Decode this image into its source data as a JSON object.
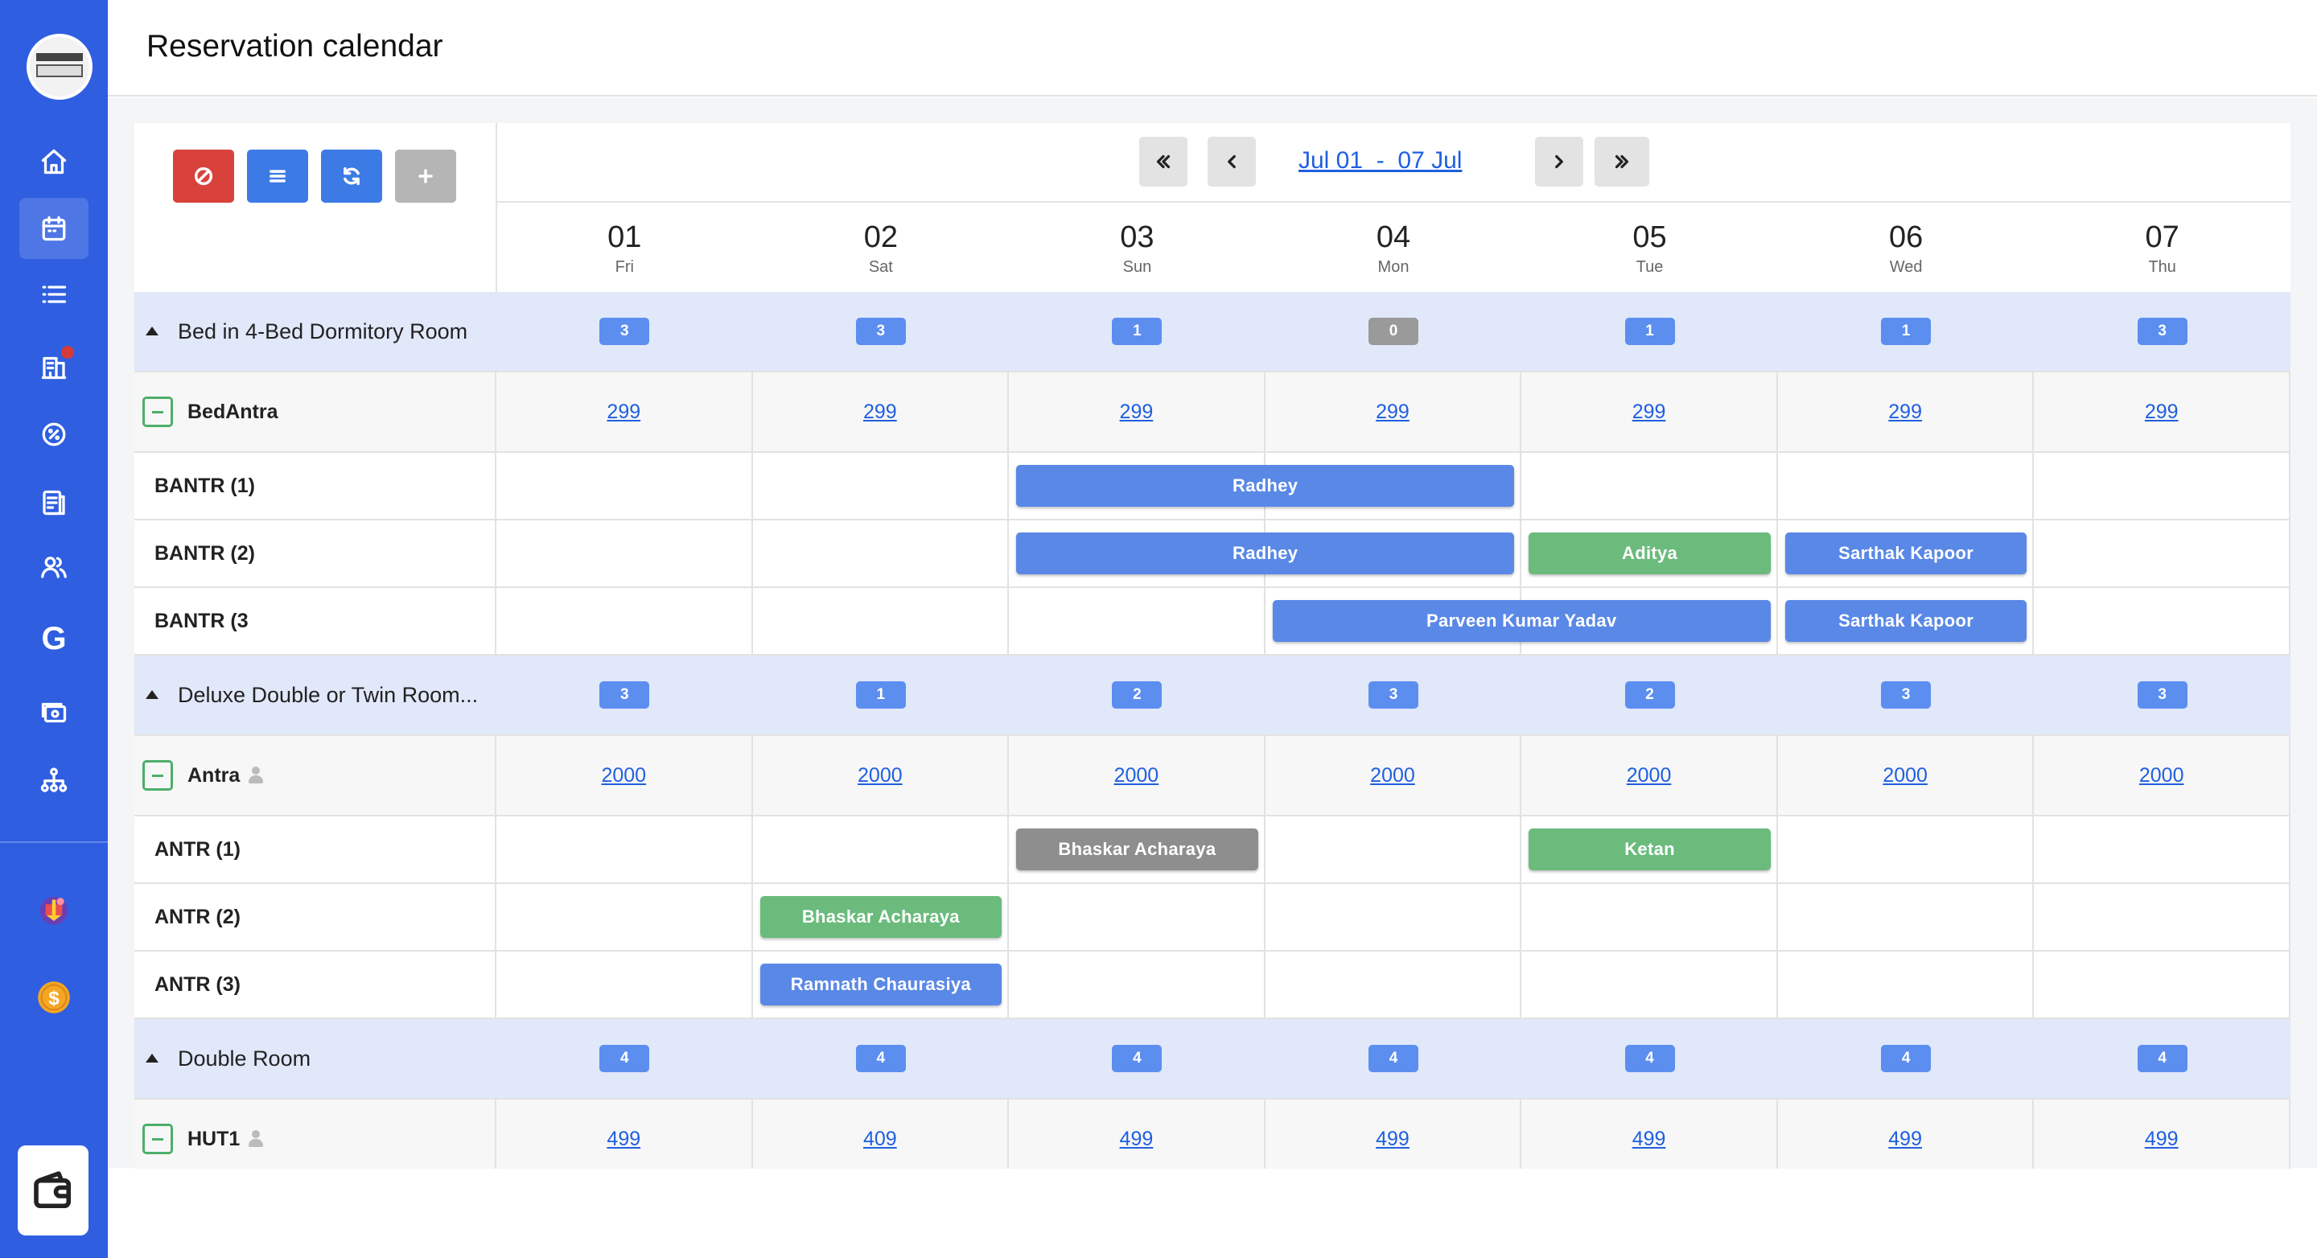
{
  "header": {
    "title": "Reservation calendar"
  },
  "sidebar": {
    "items": [
      {
        "name": "home-icon"
      },
      {
        "name": "calendar-icon",
        "active": true
      },
      {
        "name": "list-icon"
      },
      {
        "name": "building-icon",
        "notification": true
      },
      {
        "name": "discount-icon"
      },
      {
        "name": "report-icon"
      },
      {
        "name": "users-icon"
      },
      {
        "name": "google-icon",
        "glyph": "G"
      },
      {
        "name": "payment-icon"
      },
      {
        "name": "sitemap-icon"
      },
      {
        "name": "offer-icon"
      },
      {
        "name": "dollar-coin-icon"
      }
    ],
    "wallet": "wallet-icon"
  },
  "toolbar": {
    "buttons": [
      {
        "name": "block-button",
        "color": "#d9423b"
      },
      {
        "name": "list-view-button",
        "color": "#3c7be6"
      },
      {
        "name": "refresh-button",
        "color": "#3c7be6"
      },
      {
        "name": "add-button",
        "color": "#b5b5b5"
      }
    ]
  },
  "date_nav": {
    "range": "Jul 01  -  07 Jul"
  },
  "days": [
    {
      "num": "01",
      "name": "Fri"
    },
    {
      "num": "02",
      "name": "Sat"
    },
    {
      "num": "03",
      "name": "Sun"
    },
    {
      "num": "04",
      "name": "Mon"
    },
    {
      "num": "05",
      "name": "Tue"
    },
    {
      "num": "06",
      "name": "Wed"
    },
    {
      "num": "07",
      "name": "Thu"
    }
  ],
  "room_types": [
    {
      "name": "Bed in 4-Bed Dormitory Room",
      "availability": [
        "3",
        "3",
        "1",
        "0",
        "1",
        "1",
        "3"
      ],
      "rate_plan": {
        "name": "BedAntra",
        "has_person_icon": false,
        "rates": [
          "299",
          "299",
          "299",
          "299",
          "299",
          "299",
          "299"
        ]
      },
      "rooms": [
        {
          "name": "BANTR (1)",
          "bookings": [
            {
              "guest": "Radhey",
              "start": 2,
              "span": 2,
              "color": "blue"
            }
          ]
        },
        {
          "name": "BANTR (2)",
          "bookings": [
            {
              "guest": "Radhey",
              "start": 2,
              "span": 2,
              "color": "blue"
            },
            {
              "guest": "Aditya",
              "start": 4,
              "span": 1,
              "color": "green"
            },
            {
              "guest": "Sarthak Kapoor",
              "start": 5,
              "span": 1,
              "color": "blue"
            }
          ]
        },
        {
          "name": "BANTR (3",
          "bookings": [
            {
              "guest": "Parveen Kumar Yadav",
              "start": 3,
              "span": 2,
              "color": "blue"
            },
            {
              "guest": "Sarthak Kapoor",
              "start": 5,
              "span": 1,
              "color": "blue"
            }
          ]
        }
      ]
    },
    {
      "name": "Deluxe Double or Twin Room...",
      "availability": [
        "3",
        "1",
        "2",
        "3",
        "2",
        "3",
        "3"
      ],
      "rate_plan": {
        "name": "Antra",
        "has_person_icon": true,
        "rates": [
          "2000",
          "2000",
          "2000",
          "2000",
          "2000",
          "2000",
          "2000"
        ]
      },
      "rooms": [
        {
          "name": "ANTR (1)",
          "bookings": [
            {
              "guest": "Bhaskar Acharaya",
              "start": 2,
              "span": 1,
              "color": "gray"
            },
            {
              "guest": "Ketan",
              "start": 4,
              "span": 1,
              "color": "green"
            }
          ]
        },
        {
          "name": "ANTR (2)",
          "bookings": [
            {
              "guest": "Bhaskar Acharaya",
              "start": 1,
              "span": 1,
              "color": "green"
            }
          ]
        },
        {
          "name": "ANTR (3)",
          "bookings": [
            {
              "guest": "Ramnath Chaurasiya",
              "start": 1,
              "span": 1,
              "color": "blue"
            }
          ]
        }
      ]
    },
    {
      "name": "Double Room",
      "availability": [
        "4",
        "4",
        "4",
        "4",
        "4",
        "4",
        "4"
      ],
      "rate_plan": {
        "name": "HUT1",
        "has_person_icon": true,
        "rates": [
          "499",
          "409",
          "499",
          "499",
          "499",
          "499",
          "499"
        ]
      },
      "rooms": []
    }
  ]
}
